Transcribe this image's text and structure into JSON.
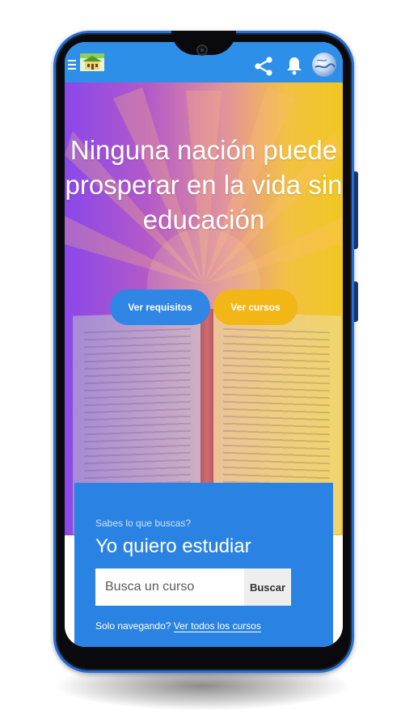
{
  "hero": {
    "headline": "Ninguna nación puede prosperar en la vida sin educación",
    "btn_requirements": "Ver requisitos",
    "btn_courses": "Ver cursos"
  },
  "search": {
    "hint": "Sabes lo que buscas?",
    "title": "Yo quiero estudiar",
    "placeholder": "Busca un curso",
    "button": "Buscar",
    "browse_prefix": "Solo navegando?",
    "browse_link": "Ver todos los cursos"
  },
  "icons": {
    "menu": "menu-icon",
    "share": "share-icon",
    "notifications": "bell-icon",
    "profile": "avatar"
  },
  "colors": {
    "appbar": "#2e8fe8",
    "primary_button": "#2f86e4",
    "secondary_button": "#f3b617",
    "search_panel": "#2a83e2",
    "phone_frame": "#1f6fe0"
  }
}
